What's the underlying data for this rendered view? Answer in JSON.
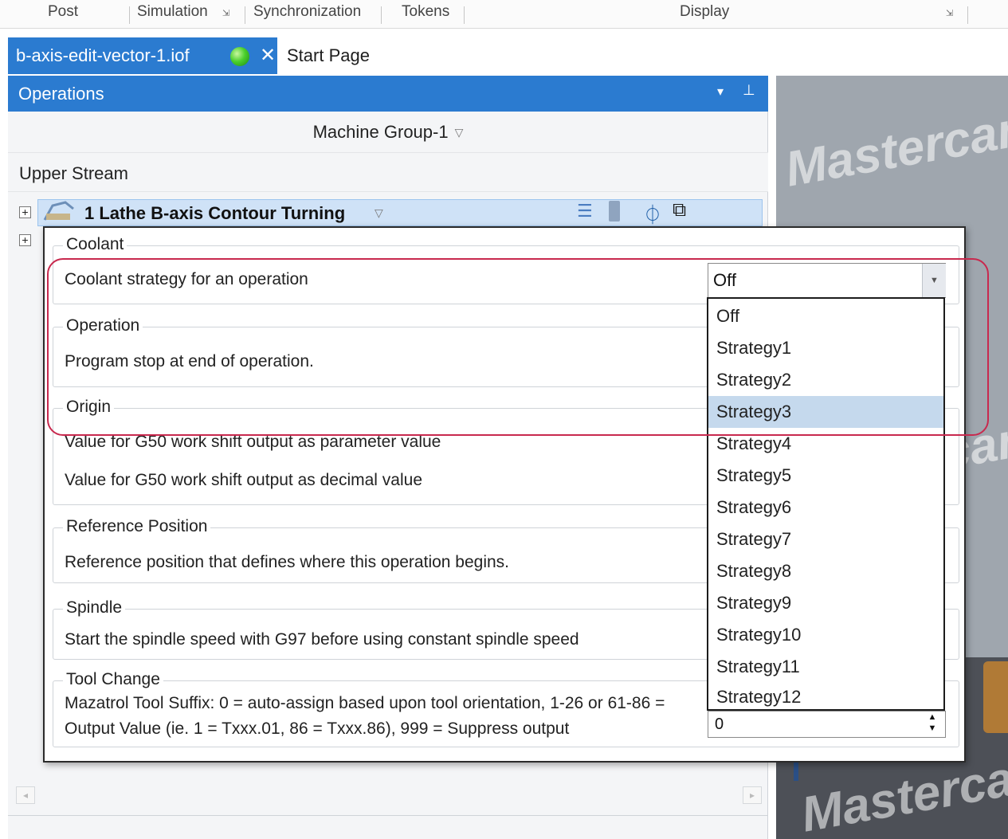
{
  "ribbon": {
    "groups": [
      "Post",
      "Simulation",
      "Synchronization",
      "Tokens",
      "Display"
    ]
  },
  "tabs": {
    "active": "b-axis-edit-vector-1.iof",
    "close_glyph": "✕",
    "other": "Start Page"
  },
  "operations_panel": {
    "title": "Operations",
    "machine_group": "Machine Group-1",
    "upper_stream": "Upper Stream",
    "operation_title": "1 Lathe B-axis Contour Turning"
  },
  "popup": {
    "coolant": {
      "title": "Coolant",
      "setting": "Coolant strategy for an operation",
      "value": "Off"
    },
    "operation": {
      "title": "Operation",
      "setting": "Program stop at end of operation."
    },
    "origin": {
      "title": "Origin",
      "setting1": "Value for G50 work shift output as parameter value",
      "setting2": "Value for G50 work shift output as decimal value"
    },
    "reference": {
      "title": "Reference Position",
      "setting": "Reference position that defines where this operation begins."
    },
    "spindle": {
      "title": "Spindle",
      "setting": "Start the spindle speed with G97 before using constant spindle speed"
    },
    "tool_change": {
      "title": "Tool Change",
      "setting": "Mazatrol Tool Suffix: 0 = auto-assign based upon tool orientation, 1-26 or 61-86 = Output Value (ie. 1 = Txxx.01, 86 = Txxx.86), 999 = Suppress output",
      "value": "0"
    }
  },
  "dropdown": {
    "options": [
      "Off",
      "Strategy1",
      "Strategy2",
      "Strategy3",
      "Strategy4",
      "Strategy5",
      "Strategy6",
      "Strategy7",
      "Strategy8",
      "Strategy9",
      "Strategy10",
      "Strategy11",
      "Strategy12"
    ],
    "hovered": "Strategy3"
  },
  "viewport": {
    "watermark": "Mastercam"
  },
  "colors": {
    "accent": "#2b7bd0",
    "annotation": "#c8294e",
    "hover": "#c5d9ed"
  }
}
